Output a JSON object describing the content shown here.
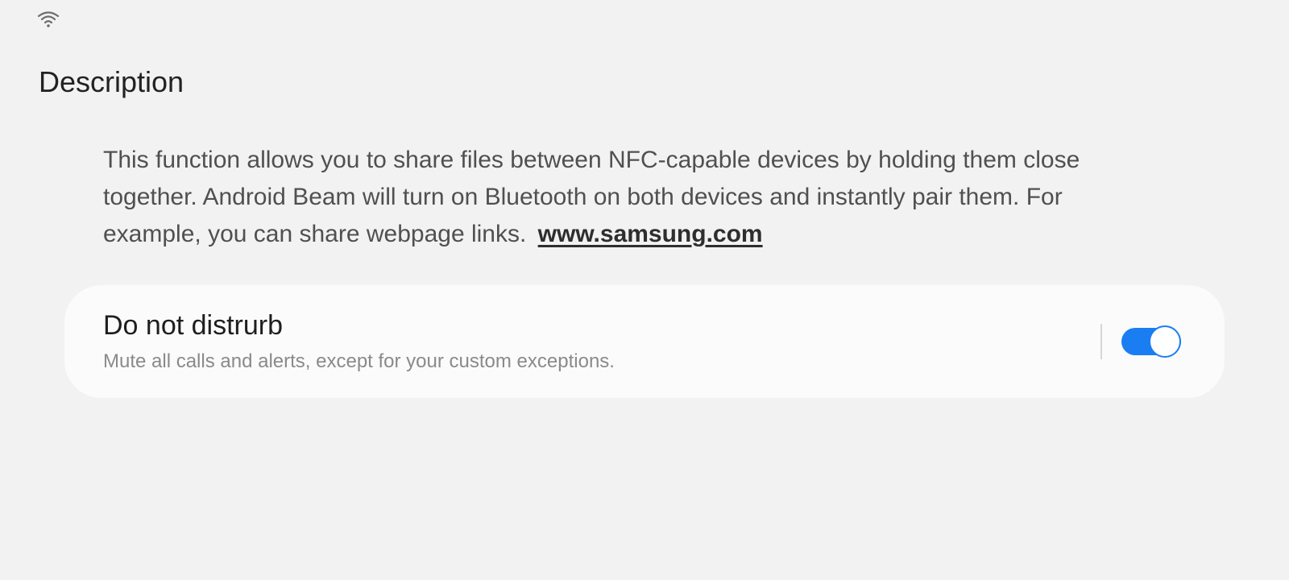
{
  "status_bar": {
    "wifi_icon": "wifi-icon"
  },
  "page": {
    "title": "Description",
    "description": "This function allows you to share files between NFC-capable devices by holding them close together. Android Beam will  turn on Bluetooth on both devices and instantly pair them. For example, you can share webpage links.",
    "link_text": "www.samsung.com"
  },
  "setting": {
    "title": "Do not distrurb",
    "subtitle": "Mute all calls and alerts, except for your custom exceptions.",
    "toggle_on": true,
    "accent_color": "#1a7ef2"
  }
}
